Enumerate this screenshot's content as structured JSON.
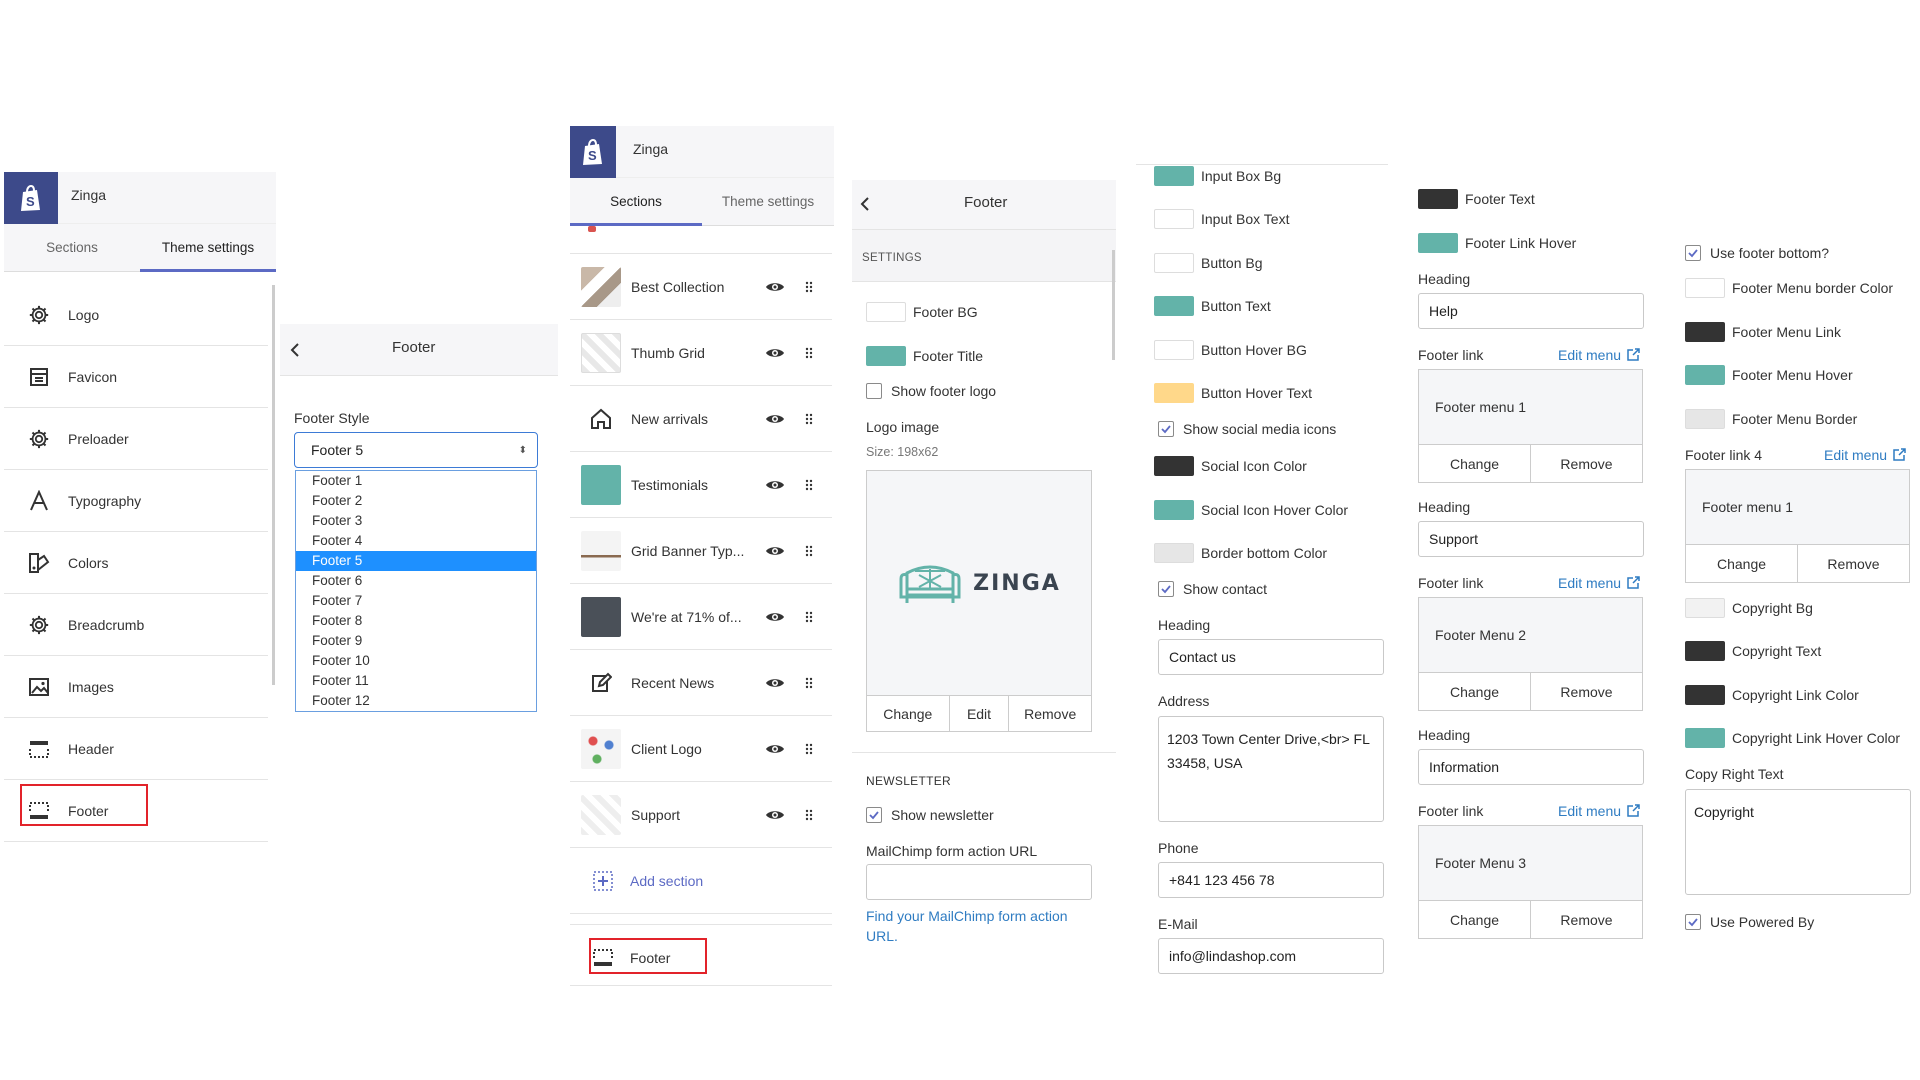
{
  "panel1": {
    "store_name": "Zinga",
    "tabs": [
      "Sections",
      "Theme settings"
    ],
    "items": [
      {
        "label": "Logo",
        "icon": "gear-icon"
      },
      {
        "label": "Favicon",
        "icon": "favicon-icon"
      },
      {
        "label": "Preloader",
        "icon": "gear-icon"
      },
      {
        "label": "Typography",
        "icon": "typography-icon"
      },
      {
        "label": "Colors",
        "icon": "colors-icon"
      },
      {
        "label": "Breadcrumb",
        "icon": "gear-icon"
      },
      {
        "label": "Images",
        "icon": "image-icon"
      },
      {
        "label": "Header",
        "icon": "header-icon"
      },
      {
        "label": "Footer",
        "icon": "footer-icon"
      }
    ]
  },
  "panel2": {
    "title": "Footer",
    "style_label": "Footer Style",
    "selected": "Footer 5",
    "options": [
      "Footer 1",
      "Footer 2",
      "Footer 3",
      "Footer 4",
      "Footer 5",
      "Footer 6",
      "Footer 7",
      "Footer 8",
      "Footer 9",
      "Footer 10",
      "Footer 11",
      "Footer 12"
    ]
  },
  "panel3": {
    "store_name": "Zinga",
    "tabs": [
      "Sections",
      "Theme settings"
    ],
    "sections": [
      {
        "label": "Best Collection"
      },
      {
        "label": "Thumb Grid"
      },
      {
        "label": "New arrivals"
      },
      {
        "label": "Testimonials"
      },
      {
        "label": "Grid Banner Typ..."
      },
      {
        "label": "We're at 71% of..."
      },
      {
        "label": "Recent News"
      },
      {
        "label": "Client Logo"
      },
      {
        "label": "Support"
      }
    ],
    "add_section": "Add section",
    "footer": "Footer"
  },
  "panel4": {
    "title": "Footer",
    "settings_header": "SETTINGS",
    "footer_bg": "Footer BG",
    "footer_title": "Footer Title",
    "show_footer_logo": "Show footer logo",
    "logo_image": "Logo image",
    "size": "Size: 198x62",
    "logo_text": "ZINGA",
    "btn_change": "Change",
    "btn_edit": "Edit",
    "btn_remove": "Remove",
    "newsletter_header": "NEWSLETTER",
    "show_newsletter": "Show newsletter",
    "mailchimp_label": "MailChimp form action URL",
    "mailchimp_value": "",
    "mailchimp_link": "Find your MailChimp form action URL."
  },
  "panel5": {
    "input_box_bg": "Input Box Bg",
    "input_box_text": "Input Box Text",
    "button_bg": "Button Bg",
    "button_text": "Button Text",
    "button_hover_bg": "Button Hover BG",
    "button_hover_text": "Button Hover Text",
    "show_social": "Show social media icons",
    "social_icon_color": "Social Icon Color",
    "social_icon_hover": "Social Icon Hover Color",
    "border_bottom_color": "Border bottom Color",
    "show_contact": "Show contact",
    "heading_label": "Heading",
    "heading_value": "Contact us",
    "address_label": "Address",
    "address_value": "1203 Town Center Drive,<br> FL 33458, USA",
    "phone_label": "Phone",
    "phone_value": "+841 123 456 78",
    "email_label": "E-Mail",
    "email_value": "info@lindashop.com"
  },
  "panel6": {
    "footer_text": "Footer Text",
    "footer_link_hover": "Footer Link Hover",
    "heading_label": "Heading",
    "footer_link_label": "Footer link",
    "edit_menu": "Edit menu",
    "change": "Change",
    "remove": "Remove",
    "groups": [
      {
        "heading": "Help",
        "menu": "Footer menu 1"
      },
      {
        "heading": "Support",
        "menu": "Footer Menu 2"
      },
      {
        "heading": "Information",
        "menu": "Footer Menu 3"
      }
    ]
  },
  "panel7": {
    "use_footer_bottom": "Use footer bottom?",
    "menu_border_color": "Footer Menu border Color",
    "menu_link": "Footer Menu Link",
    "menu_hover": "Footer Menu Hover",
    "menu_border": "Footer Menu Border",
    "footer_link4": "Footer link 4",
    "edit_menu": "Edit menu",
    "menu": "Footer menu 1",
    "change": "Change",
    "remove": "Remove",
    "copyright_bg": "Copyright Bg",
    "copyright_text": "Copyright Text",
    "copyright_link": "Copyright Link Color",
    "copyright_link_hover": "Copyright Link Hover Color",
    "copy_right_label": "Copy Right Text",
    "copy_right_value": "Copyright",
    "use_powered_by": "Use Powered By"
  },
  "colors": {
    "brand": "#3d4a8a",
    "accent": "#5c6ac4",
    "teal": "#63b3a9",
    "dark": "#333333",
    "light": "#ffffff",
    "pale_gray": "#e6e6e6",
    "amber": "#ffd88a",
    "highlight": "#e2232a",
    "link": "#2f7cc2"
  }
}
